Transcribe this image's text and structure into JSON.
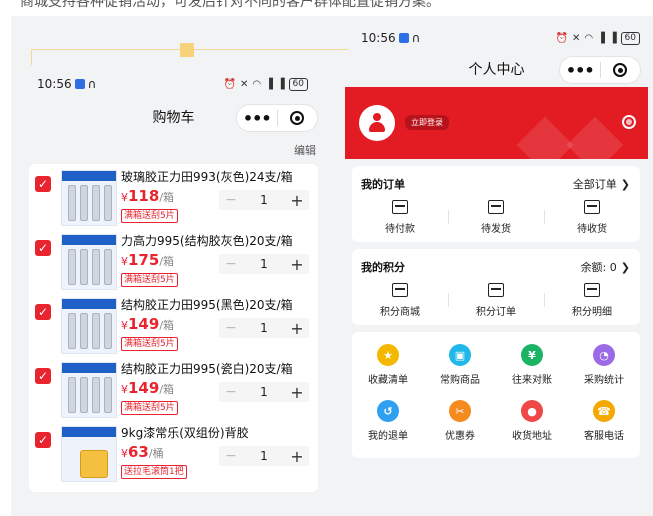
{
  "caption": "商城支持各种促销活动，可发后针对不同的客户群体配置促销方案。",
  "status": {
    "time": "10:56",
    "battery": "60"
  },
  "cart_page": {
    "title": "购物车",
    "edit": "编辑",
    "items": [
      {
        "name": "玻璃胶正力田993(灰色)24支/箱",
        "currency": "¥",
        "price": "118",
        "unit": "/箱",
        "promo": "满箱送刮5片",
        "qty": "1",
        "thumb": "tubes"
      },
      {
        "name": "力高力995(结构胶灰色)20支/箱",
        "currency": "¥",
        "price": "175",
        "unit": "/箱",
        "promo": "满箱送刮5片",
        "qty": "1",
        "thumb": "tubes"
      },
      {
        "name": "结构胶正力田995(黑色)20支/箱",
        "currency": "¥",
        "price": "149",
        "unit": "/箱",
        "promo": "满箱送刮5片",
        "qty": "1",
        "thumb": "tubes"
      },
      {
        "name": "结构胶正力田995(瓷白)20支/箱",
        "currency": "¥",
        "price": "149",
        "unit": "/箱",
        "promo": "满箱送刮5片",
        "qty": "1",
        "thumb": "tubes"
      },
      {
        "name": "9kg漆常乐(双组份)背胶",
        "currency": "¥",
        "price": "63",
        "unit": "/桶",
        "promo": "送拉毛滚筒1把",
        "qty": "1",
        "thumb": "bucket"
      }
    ]
  },
  "profile_page": {
    "title": "个人中心",
    "login_label": "立即登录",
    "orders": {
      "title": "我的订单",
      "link": "全部订单",
      "items": [
        {
          "label": "待付款",
          "icon": "wallet-icon"
        },
        {
          "label": "待发货",
          "icon": "package-icon"
        },
        {
          "label": "待收货",
          "icon": "truck-icon"
        }
      ]
    },
    "points": {
      "title": "我的积分",
      "link": "余额:",
      "balance": "0",
      "items": [
        {
          "label": "积分商城",
          "icon": "points-mall-icon"
        },
        {
          "label": "积分订单",
          "icon": "points-order-icon"
        },
        {
          "label": "积分明细",
          "icon": "points-detail-icon"
        }
      ]
    },
    "grid": [
      {
        "label": "收藏清单",
        "icon": "star-icon",
        "color": "#f5b800"
      },
      {
        "label": "常购商品",
        "icon": "bag-icon",
        "color": "#1fb8e8"
      },
      {
        "label": "往来对账",
        "icon": "ledger-icon",
        "color": "#1cb464"
      },
      {
        "label": "采购统计",
        "icon": "pie-icon",
        "color": "#9b6be6"
      },
      {
        "label": "我的退单",
        "icon": "return-icon",
        "color": "#2fa0f0"
      },
      {
        "label": "优惠券",
        "icon": "coupon-icon",
        "color": "#f58a1f"
      },
      {
        "label": "收货地址",
        "icon": "location-icon",
        "color": "#f04848"
      },
      {
        "label": "客服电话",
        "icon": "headset-icon",
        "color": "#f5a800"
      }
    ]
  }
}
